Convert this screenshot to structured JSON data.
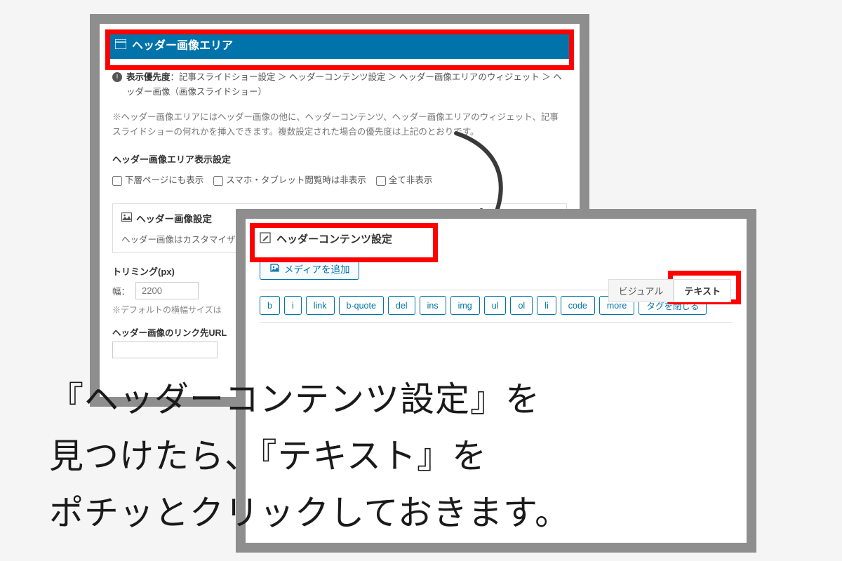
{
  "back": {
    "header_area_title": "ヘッダー画像エリア",
    "priority_label": "表示優先度",
    "priority_text": "：記事スライドショー設定 ＞ ヘッダーコンテンツ設定 ＞ ヘッダー画像エリアのウィジェット ＞ ヘッダー画像（画像スライドショー）",
    "note": "※ヘッダー画像エリアにはヘッダー画像の他に、ヘッダーコンテンツ、ヘッダー画像エリアのウィジェット、記事スライドショーの何れかを挿入できます。複数設定された場合の優先度は上記のとおりです。",
    "display_settings_title": "ヘッダー画像エリア表示設定",
    "checks": {
      "lower_pages": "下層ページにも表示",
      "hide_sp": "スマホ・タブレット閲覧時は非表示",
      "hide_all": "全て非表示"
    },
    "image_settings_title": "ヘッダー画像設定",
    "image_settings_text": "ヘッダー画像はカスタマイザ",
    "trimming_label": "トリミング(px)",
    "width_label": "幅：",
    "width_placeholder": "2200",
    "default_note": "※デフォルトの横幅サイズは",
    "link_url_label": "ヘッダー画像のリンク先URL"
  },
  "front": {
    "title": "ヘッダーコンテンツ設定",
    "add_media": "メディアを追加",
    "tab_visual": "ビジュアル",
    "tab_text": "テキスト",
    "toolbar": [
      "b",
      "i",
      "link",
      "b-quote",
      "del",
      "ins",
      "img",
      "ul",
      "ol",
      "li",
      "code",
      "more",
      "タグを閉じる"
    ]
  },
  "overlay": {
    "line1": "『ヘッダーコンテンツ設定』を",
    "line2": "見つけたら、『テキスト』を",
    "line3": "ポチッとクリックしておきます。"
  }
}
